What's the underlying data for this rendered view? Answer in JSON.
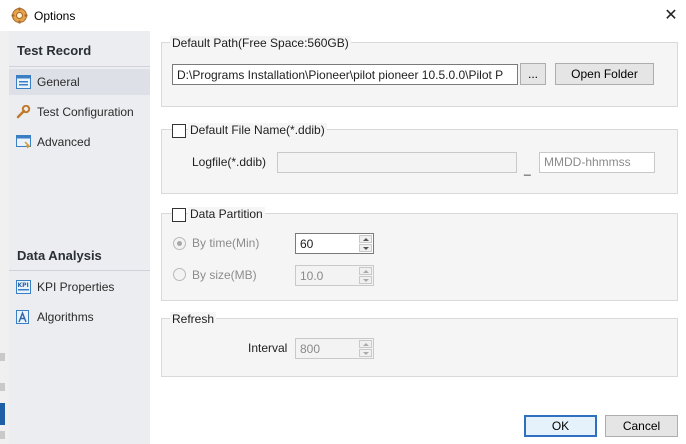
{
  "window": {
    "title": "Options",
    "close_glyph": "✕"
  },
  "sidebar": {
    "test_record": {
      "header": "Test Record",
      "items": [
        {
          "label": "General",
          "icon": "general-icon",
          "selected": true
        },
        {
          "label": "Test Configuration",
          "icon": "wrench-icon"
        },
        {
          "label": "Advanced",
          "icon": "advanced-icon"
        }
      ]
    },
    "data_analysis": {
      "header": "Data Analysis",
      "items": [
        {
          "label": "KPI Properties",
          "icon": "kpi-icon"
        },
        {
          "label": "Algorithms",
          "icon": "algorithm-icon"
        }
      ]
    }
  },
  "default_path": {
    "title": "Default Path(Free Space:560GB)",
    "path_value": "D:\\Programs Installation\\Pioneer\\pilot pioneer 10.5.0.0\\Pilot P",
    "browse_label": "...",
    "open_folder_label": "Open Folder"
  },
  "file_name": {
    "checkbox_label": "Default File Name(*.ddib)",
    "checked": false,
    "logfile_label": "Logfile(*.ddib)",
    "logfile_value": "",
    "separator": "_",
    "suffix_placeholder": "MMDD-hhmmss"
  },
  "partition": {
    "checkbox_label": "Data Partition",
    "checked": false,
    "by_time_label": "By time(Min)",
    "by_time_value": "60",
    "by_size_label": "By size(MB)",
    "by_size_value": "10.0"
  },
  "refresh": {
    "title": "Refresh",
    "interval_label": "Interval",
    "interval_value": "800"
  },
  "footer": {
    "ok_label": "OK",
    "cancel_label": "Cancel"
  },
  "colors": {
    "accent": "#2f6fbf",
    "sidebar_bg": "#ecedf0",
    "panel_bg": "#f5f5f5"
  }
}
